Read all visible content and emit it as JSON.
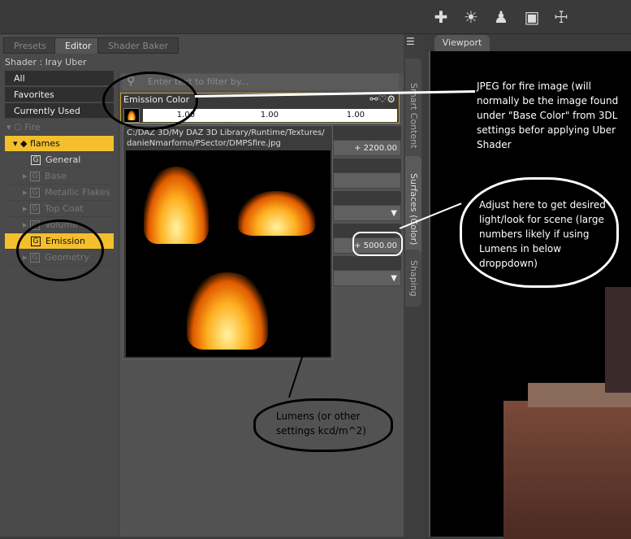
{
  "toolbar": {
    "icons": [
      "new-light-icon",
      "environment-icon",
      "transfer-figure-icon",
      "save-shader-icon",
      "save-figure-icon"
    ]
  },
  "left_panel": {
    "tabs": [
      "Presets",
      "Editor",
      "Shader Baker"
    ],
    "active_tab": "Editor",
    "shader_label": "Shader : Iray Uber",
    "categories": [
      "All",
      "Favorites",
      "Currently Used"
    ],
    "tree": [
      {
        "label": "Fire",
        "level": 0
      },
      {
        "label": "flames",
        "level": 1,
        "selected": true
      },
      {
        "label": "General",
        "level": 2
      },
      {
        "label": "Base",
        "level": 2
      },
      {
        "label": "Metallic Flakes",
        "level": 2
      },
      {
        "label": "Top Coat",
        "level": 2
      },
      {
        "label": "Volume",
        "level": 2
      },
      {
        "label": "Emission",
        "level": 2,
        "selected": true
      },
      {
        "label": "Geometry",
        "level": 2
      }
    ]
  },
  "properties": {
    "filter_placeholder": "Enter text to filter by...",
    "emission_color_label": "Emission Color",
    "emission_values": [
      "1.00",
      "1.00",
      "1.00"
    ],
    "temperature_value": "2200.00",
    "luminance_value": "5000.00"
  },
  "texture_popup": {
    "path_line1": "C:/DAZ 3D/My DAZ 3D Library/Runtime/Textures/",
    "path_line2": "danieNmarforno/PSector/DMPSfire.jpg"
  },
  "side_tabs": [
    "Smart Content",
    "Surfaces (Color)",
    "Shaping"
  ],
  "viewport": {
    "tab": "Viewport"
  },
  "annotations": {
    "jpeg_note": "JPEG for fire image (will normally be the image found under \"Base Color\" from 3DL settings befor applying Uber Shader",
    "adjust_note": "Adjust here to get desired light/look for scene (large numbers likely if using Lumens in below droppdown)",
    "lumens_note": "Lumens (or other settings kcd/m^2)"
  },
  "colors": {
    "accent": "#f3bf2c"
  }
}
